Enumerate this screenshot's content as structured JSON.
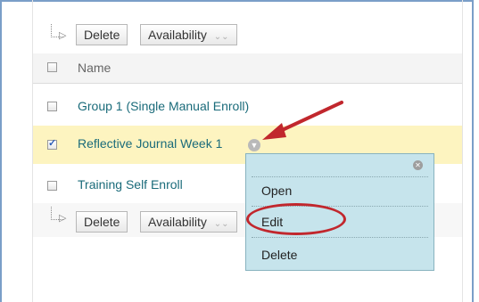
{
  "toolbar": {
    "delete_label": "Delete",
    "availability_label": "Availability"
  },
  "table": {
    "header_name": "Name",
    "rows": [
      {
        "name": "Group 1 (Single Manual Enroll)",
        "checked": false
      },
      {
        "name": "Reflective Journal Week 1",
        "checked": true
      },
      {
        "name": "Training Self Enroll",
        "checked": false
      }
    ]
  },
  "context_menu": {
    "items": [
      "Open",
      "Edit",
      "Delete"
    ]
  },
  "colors": {
    "link": "#1a6b7a",
    "selected_row": "#fdf4c0",
    "menu_bg": "#c6e4ec",
    "annotation": "#c1272d"
  },
  "icons": {
    "row_menu": "chevron-down-icon",
    "menu_close": "close-icon",
    "annotation": "red-arrow"
  }
}
